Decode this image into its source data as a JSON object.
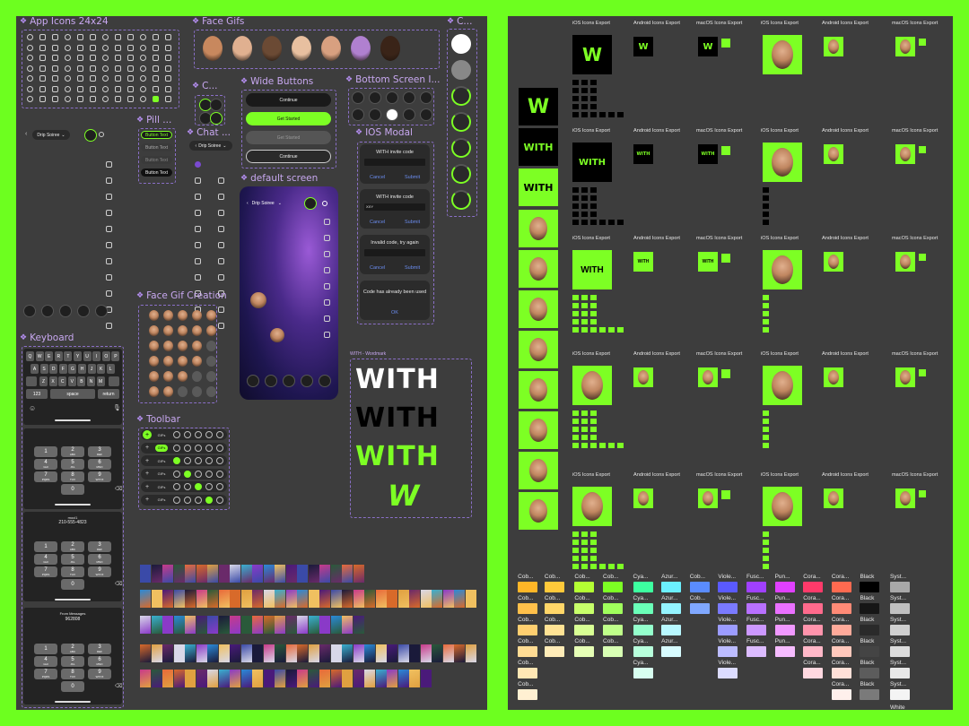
{
  "left_board": {
    "sections": {
      "app_icons": "App Icons 24x24",
      "face_gifs": "Face Gifs",
      "c_right": "C...",
      "c_small": "C...",
      "wide_buttons": "Wide Buttons",
      "bottom_screen": "Bottom Screen I...",
      "pill": "Pill ...",
      "chat": "Chat ...",
      "ios_modal": "IOS Modal",
      "default_screen": "default screen",
      "face_gif_creation": "Face Gif Creation",
      "keyboard": "Keyboard",
      "toolbar": "Toolbar",
      "wordmark": "WITH - Wordmark"
    },
    "header_dropdown": "Drip Soiree",
    "wide_buttons": [
      "Continue",
      "Get Started",
      "Get Started",
      "Continue"
    ],
    "pill_buttons": [
      "Button Text",
      "Button Text",
      "Button Text",
      "Button Text"
    ],
    "modals": [
      {
        "title": "WITH invite code",
        "cancel": "Cancel",
        "submit": "Submit"
      },
      {
        "title": "WITH invite code",
        "value": "XXY",
        "cancel": "Cancel",
        "submit": "Submit"
      },
      {
        "title": "Invalid code, try again",
        "cancel": "Cancel",
        "submit": "Submit"
      },
      {
        "title": "Code has already been used",
        "ok": "OK"
      }
    ],
    "toolbar_label": "GIFs",
    "keyboard": {
      "row1": [
        "Q",
        "W",
        "E",
        "R",
        "T",
        "Y",
        "U",
        "I",
        "O",
        "P"
      ],
      "row2": [
        "A",
        "S",
        "D",
        "F",
        "G",
        "H",
        "J",
        "K",
        "L"
      ],
      "row3": [
        "Z",
        "X",
        "C",
        "V",
        "B",
        "N",
        "M"
      ],
      "k123": "123",
      "space": "space",
      "return": "return"
    },
    "dialpad": [
      {
        "n": "1",
        "s": ""
      },
      {
        "n": "2",
        "s": "ABC"
      },
      {
        "n": "3",
        "s": "DEF"
      },
      {
        "n": "4",
        "s": "GHI"
      },
      {
        "n": "5",
        "s": "JKL"
      },
      {
        "n": "6",
        "s": "MNO"
      },
      {
        "n": "7",
        "s": "PQRS"
      },
      {
        "n": "8",
        "s": "TUV"
      },
      {
        "n": "9",
        "s": "WXYZ"
      },
      {
        "n": "0",
        "s": ""
      }
    ],
    "phone2_label": "moci1",
    "phone2_number": "210-555-4823",
    "phone3_label": "From Messages",
    "phone3_number": "962808",
    "wordmarks": [
      "WITH",
      "WITH",
      "WITH",
      "W"
    ]
  },
  "right_board": {
    "left_tiles": [
      "W",
      "WITH",
      "WITH"
    ],
    "col_labels": [
      "iOS Icons Export",
      "Android Icons Export",
      "macOS Icons Export",
      "iOS Icons Export",
      "Android Icons Export",
      "macOS Icons Export"
    ],
    "col_labels_alt": [
      "iOS Icons Export",
      "Android Icons Export",
      "macOS Icons Export",
      "iOS Icons Export",
      "Android Icons Export",
      "macOS Icons Export"
    ],
    "row_tiles": [
      "W",
      "WITH",
      "WITH"
    ],
    "swatch_labels": [
      "Cob...",
      "Cob...",
      "Cob...",
      "Cob...",
      "Cya...",
      "Azur...",
      "Cob...",
      "Viole...",
      "Fusc...",
      "Pun...",
      "Cora...",
      "Black",
      "Syst..."
    ],
    "swatch_row_labels": {
      "col5": [
        "Cya...",
        "Azur...",
        "Cob...",
        "Cya...",
        "Cya..."
      ],
      "col11": [
        "Black",
        "Syst...",
        "Syst...",
        "Syst...",
        "Syst...",
        "Syst..."
      ]
    },
    "bottom_label": "White"
  },
  "colors": {
    "green": "#7dff24",
    "bg": "#3d3d3d",
    "purple": "#b48ef0"
  }
}
